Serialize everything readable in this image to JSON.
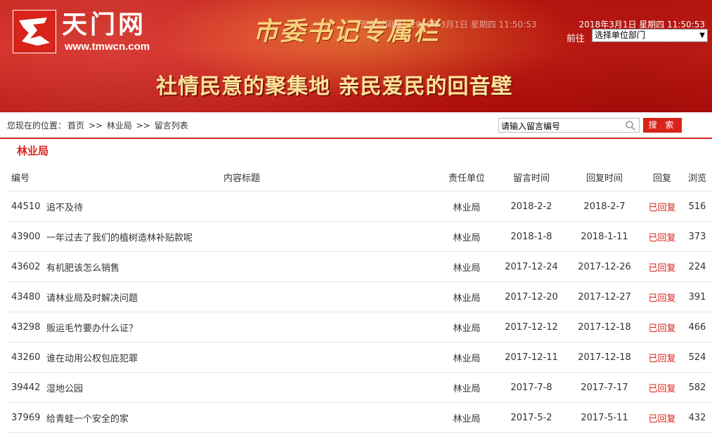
{
  "banner": {
    "logo_text": "天门网",
    "logo_url": "www.tmwcn.com",
    "slogan_top": "市委书记专属栏",
    "slogan_bottom": "社情民意的聚集地  亲民爱民的回音壁",
    "time_ghost": "现在时间是：2018年3月1日  星期四  11:50:53",
    "time_text": "2018年3月1日  星期四  11:50:53",
    "goto_label": "前往",
    "select_value": "选择单位部门",
    "colors": {
      "primary": "#d8231a",
      "gold": "#f6d27a"
    }
  },
  "location": {
    "prefix": "您现在的位置：",
    "home": "首页",
    "sep": ">>",
    "dept": "林业局",
    "list": "留言列表"
  },
  "search": {
    "placeholder": "请输入留言编号",
    "value": "请输入留言编号",
    "button": "搜 索",
    "icon": "search-icon"
  },
  "section": {
    "title": "林业局"
  },
  "table": {
    "headers": {
      "id": "编号",
      "title": "内容标题",
      "dept": "责任单位",
      "msg_time": "留言时间",
      "reply_time": "回复时间",
      "reply": "回复",
      "views": "浏览"
    },
    "rows": [
      {
        "id": "44510",
        "title": "追不及待",
        "dept": "林业局",
        "msg_time": "2018-2-2",
        "reply_time": "2018-2-7",
        "status": "已回复",
        "views": "516"
      },
      {
        "id": "43900",
        "title": "一年过去了我们的植树造林补贴款呢",
        "dept": "林业局",
        "msg_time": "2018-1-8",
        "reply_time": "2018-1-11",
        "status": "已回复",
        "views": "373"
      },
      {
        "id": "43602",
        "title": "有机肥该怎么销售",
        "dept": "林业局",
        "msg_time": "2017-12-24",
        "reply_time": "2017-12-26",
        "status": "已回复",
        "views": "224"
      },
      {
        "id": "43480",
        "title": "请林业局及时解决问题",
        "dept": "林业局",
        "msg_time": "2017-12-20",
        "reply_time": "2017-12-27",
        "status": "已回复",
        "views": "391"
      },
      {
        "id": "43298",
        "title": "贩运毛竹要办什么证？",
        "dept": "林业局",
        "msg_time": "2017-12-12",
        "reply_time": "2017-12-18",
        "status": "已回复",
        "views": "466"
      },
      {
        "id": "43260",
        "title": "谁在动用公权包庇犯罪",
        "dept": "林业局",
        "msg_time": "2017-12-11",
        "reply_time": "2017-12-18",
        "status": "已回复",
        "views": "524"
      },
      {
        "id": "39442",
        "title": "湿地公园",
        "dept": "林业局",
        "msg_time": "2017-7-8",
        "reply_time": "2017-7-17",
        "status": "已回复",
        "views": "582"
      },
      {
        "id": "37969",
        "title": "给青蛙一个安全的家",
        "dept": "林业局",
        "msg_time": "2017-5-2",
        "reply_time": "2017-5-11",
        "status": "已回复",
        "views": "432"
      }
    ]
  }
}
